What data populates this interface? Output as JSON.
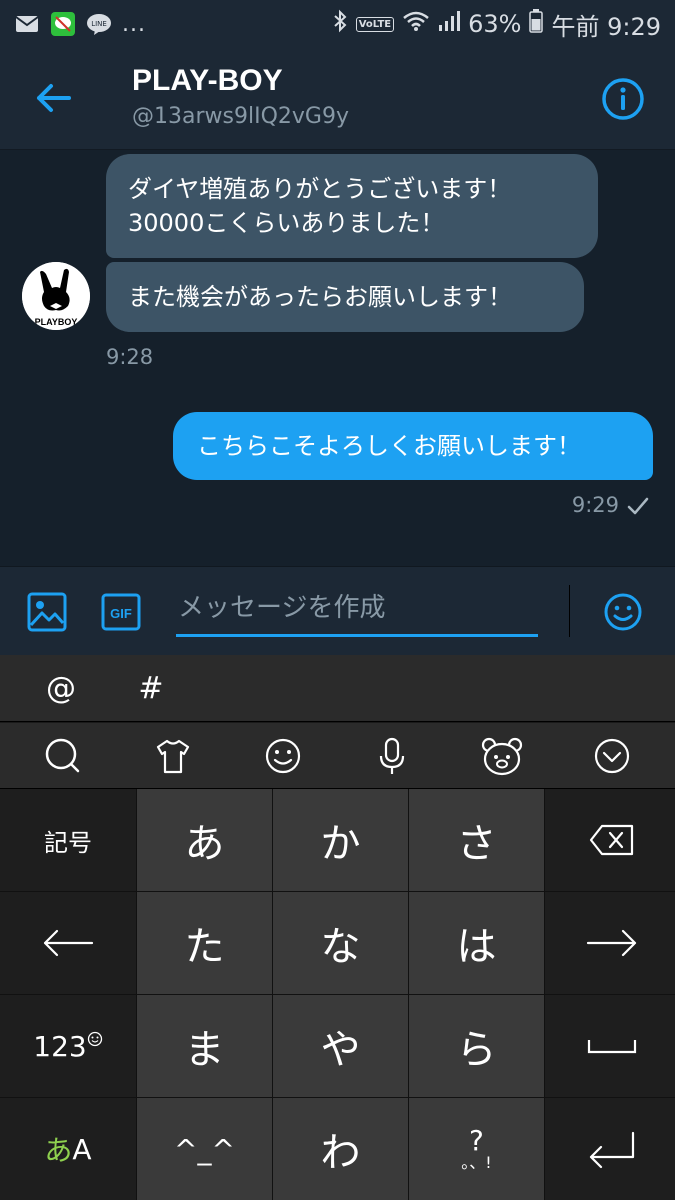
{
  "status_bar": {
    "dots": "...",
    "battery": "63%",
    "time": "午前 9:29",
    "volte": "VoLTE",
    "line_label": "LINE"
  },
  "header": {
    "title": "PLAY-BOY",
    "handle": "@13arws9lIQ2vG9y"
  },
  "conversation": {
    "incoming": [
      {
        "line1": "ダイヤ増殖ありがとうございます！",
        "line2": "30000こくらいありました！"
      },
      {
        "line1": "また機会があったらお願いします！"
      }
    ],
    "incoming_time": "9:28",
    "avatar_text": "PLAYBOY",
    "outgoing": [
      {
        "text": "こちらこそよろしくお願いします！"
      }
    ],
    "outgoing_time": "9:29"
  },
  "composer": {
    "placeholder": "メッセージを作成",
    "gif_label": "GIF"
  },
  "keyboard": {
    "symbols": [
      "@",
      "#"
    ],
    "rows": [
      [
        "記号",
        "あ",
        "か",
        "さ",
        ""
      ],
      [
        "",
        "た",
        "な",
        "は",
        ""
      ],
      [
        "123",
        "ま",
        "や",
        "ら",
        ""
      ],
      [
        "",
        "^_^",
        "わ",
        "",
        ""
      ]
    ],
    "kana_toggle_a": "あ",
    "kana_toggle_b": "A",
    "punct_top": "?",
    "punct_bottom": "。、!",
    "accent_color": "#1da1f2"
  }
}
